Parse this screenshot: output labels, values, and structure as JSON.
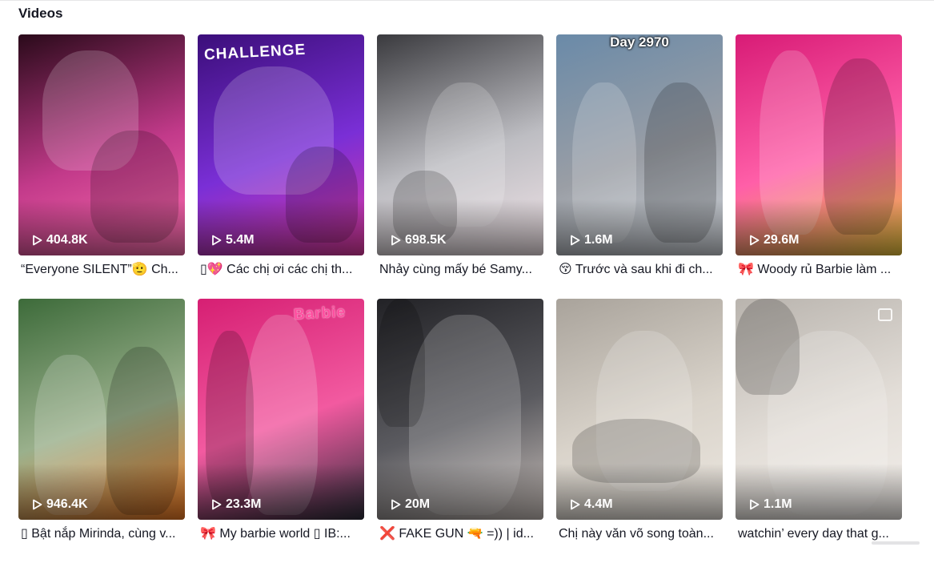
{
  "section": {
    "title": "Videos"
  },
  "videos": [
    {
      "views": "404.8K",
      "caption": "“Everyone SILENT”🫡 Ch...",
      "bg": [
        "#2a0a1a",
        "#c23a8a",
        "#ff6fb0"
      ],
      "overlay": ""
    },
    {
      "views": "5.4M",
      "caption": "▯💖 Các chị ơi các chị th...",
      "bg": [
        "#3b0e7a",
        "#7a2fd6",
        "#e23aa0"
      ],
      "overlay": "CHALLENGE"
    },
    {
      "views": "698.5K",
      "caption": "Nhảy cùng mấy bé Samy...",
      "bg": [
        "#3a3a3e",
        "#bdbdc2",
        "#f1e4e8"
      ],
      "overlay": ""
    },
    {
      "views": "1.6M",
      "caption": "😚 Trước và sau khi đi ch...",
      "bg": [
        "#6a8aa8",
        "#9a9ea5",
        "#cfd4da"
      ],
      "overlay": "Day 2970"
    },
    {
      "views": "29.6M",
      "caption": "🎀 Woody rủ Barbie làm ...",
      "bg": [
        "#d81b76",
        "#ff5fa8",
        "#e8c43a"
      ],
      "overlay": ""
    },
    {
      "views": "946.4K",
      "caption": "▯ Bật nắp Mirinda, cùng v...",
      "bg": [
        "#3d6b3a",
        "#9ab08c",
        "#f07a22"
      ],
      "overlay": ""
    },
    {
      "views": "23.3M",
      "caption": "🎀 My barbie world ▯ IB:...",
      "bg": [
        "#d61f73",
        "#f25aa0",
        "#2d2d3a"
      ],
      "overlay": "Barbie"
    },
    {
      "views": "20M",
      "caption": "❌ FAKE GUN 🔫 =)) | id...",
      "bg": [
        "#222226",
        "#5b5b60",
        "#c9c0bb"
      ],
      "overlay": ""
    },
    {
      "views": "4.4M",
      "caption": "Chị này văn võ song toàn...",
      "bg": [
        "#a9a39b",
        "#d9d3ca",
        "#ece7e0"
      ],
      "overlay": ""
    },
    {
      "views": "1.1M",
      "caption": "watchin’ every day that g...",
      "bg": [
        "#b9b4ae",
        "#e3ded8",
        "#f2eeea"
      ],
      "overlay": ""
    }
  ]
}
